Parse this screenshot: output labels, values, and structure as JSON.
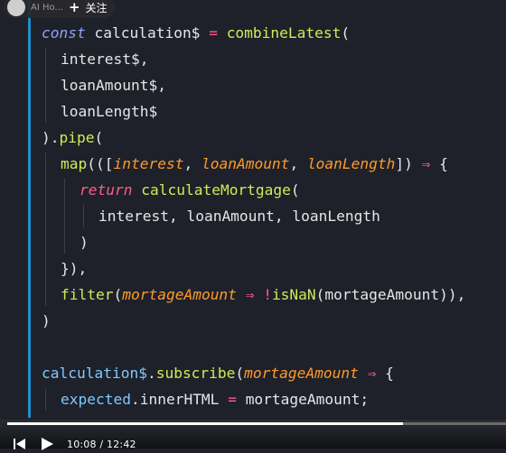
{
  "overlay": {
    "handle": "AI Ho...",
    "follow_label": "关注"
  },
  "editor": {
    "lines": [
      {
        "indent": 0,
        "tokens": [
          {
            "t": "const",
            "c": "kw"
          },
          {
            "t": " "
          },
          {
            "t": "calculation$",
            "c": "var"
          },
          {
            "t": " "
          },
          {
            "t": "=",
            "c": "op"
          },
          {
            "t": " "
          },
          {
            "t": "combineLatest",
            "c": "fn"
          },
          {
            "t": "(",
            "c": "punc"
          }
        ]
      },
      {
        "indent": 1,
        "tokens": [
          {
            "t": "interest$,",
            "c": "var"
          }
        ]
      },
      {
        "indent": 1,
        "tokens": [
          {
            "t": "loanAmount$,",
            "c": "var"
          }
        ]
      },
      {
        "indent": 1,
        "tokens": [
          {
            "t": "loanLength$",
            "c": "var"
          }
        ]
      },
      {
        "indent": 0,
        "tokens": [
          {
            "t": ").",
            "c": "punc"
          },
          {
            "t": "pipe",
            "c": "fn"
          },
          {
            "t": "(",
            "c": "punc"
          }
        ]
      },
      {
        "indent": 1,
        "tokens": [
          {
            "t": "map",
            "c": "fn"
          },
          {
            "t": "(([",
            "c": "punc"
          },
          {
            "t": "interest",
            "c": "param"
          },
          {
            "t": ", ",
            "c": "punc"
          },
          {
            "t": "loanAmount",
            "c": "param"
          },
          {
            "t": ", ",
            "c": "punc"
          },
          {
            "t": "loanLength",
            "c": "param"
          },
          {
            "t": "])",
            "c": "punc"
          },
          {
            "t": " "
          },
          {
            "t": "⇒",
            "c": "op"
          },
          {
            "t": " "
          },
          {
            "t": "{",
            "c": "punc"
          }
        ]
      },
      {
        "indent": 2,
        "tokens": [
          {
            "t": "return",
            "c": "ret"
          },
          {
            "t": " "
          },
          {
            "t": "calculateMortgage",
            "c": "fn"
          },
          {
            "t": "(",
            "c": "punc"
          }
        ]
      },
      {
        "indent": 3,
        "tokens": [
          {
            "t": "interest, loanAmount, loanLength",
            "c": "var"
          }
        ]
      },
      {
        "indent": 2,
        "tokens": [
          {
            "t": ")",
            "c": "punc"
          }
        ]
      },
      {
        "indent": 1,
        "tokens": [
          {
            "t": "}),",
            "c": "punc"
          }
        ]
      },
      {
        "indent": 1,
        "tokens": [
          {
            "t": "filter",
            "c": "fn"
          },
          {
            "t": "(",
            "c": "punc"
          },
          {
            "t": "mortageAmount",
            "c": "param"
          },
          {
            "t": " "
          },
          {
            "t": "⇒",
            "c": "op"
          },
          {
            "t": " "
          },
          {
            "t": "!",
            "c": "op"
          },
          {
            "t": "isNaN",
            "c": "fn"
          },
          {
            "t": "(mortageAmount)),",
            "c": "var"
          }
        ]
      },
      {
        "indent": 0,
        "tokens": [
          {
            "t": ")",
            "c": "punc"
          }
        ]
      },
      {
        "indent": 0,
        "tokens": []
      },
      {
        "indent": 0,
        "tokens": [
          {
            "t": "calculation$",
            "c": "field"
          },
          {
            "t": ".",
            "c": "punc"
          },
          {
            "t": "subscribe",
            "c": "fn"
          },
          {
            "t": "(",
            "c": "punc"
          },
          {
            "t": "mortageAmount",
            "c": "param"
          },
          {
            "t": " "
          },
          {
            "t": "⇒",
            "c": "op"
          },
          {
            "t": " "
          },
          {
            "t": "{",
            "c": "punc"
          }
        ]
      },
      {
        "indent": 1,
        "tokens": [
          {
            "t": "expected",
            "c": "field"
          },
          {
            "t": ".innerHTML",
            "c": "var"
          },
          {
            "t": " "
          },
          {
            "t": "=",
            "c": "op"
          },
          {
            "t": " "
          },
          {
            "t": "mortageAmount;",
            "c": "var"
          }
        ]
      },
      {
        "indent": 0,
        "tokens": [
          {
            "t": "});",
            "c": "punc"
          }
        ]
      }
    ]
  },
  "colors": {
    "background": "#1e2129",
    "gutter_accent": "#1f90cf",
    "keyword": "#8fa3ff",
    "operator": "#ff5c8a",
    "function": "#d6e85a",
    "parameter": "#ff9a2b",
    "field": "#7fc8ff"
  },
  "player": {
    "current_time": "10:08",
    "separator": "/",
    "total_time": "12:42",
    "progress": 0.794,
    "prev_icon": "skip-previous-icon",
    "play_icon": "play-icon"
  }
}
